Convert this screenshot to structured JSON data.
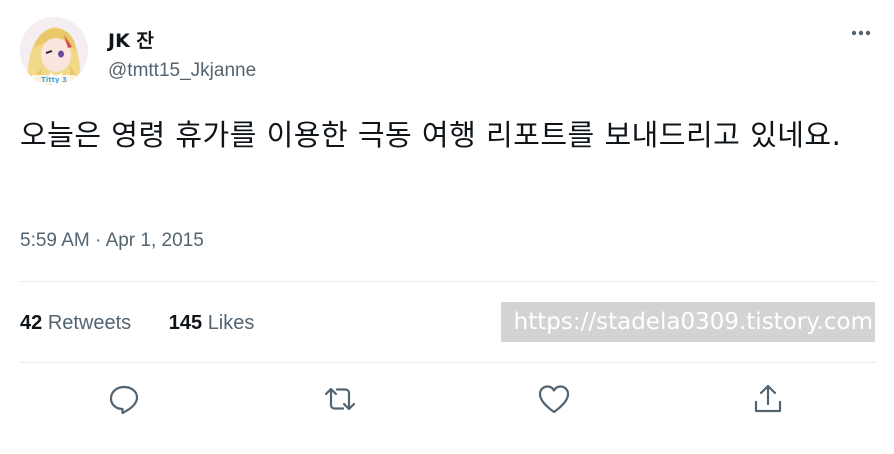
{
  "author": {
    "display_name": "JK 잔",
    "handle": "@tmtt15_Jkjanne",
    "avatar_text": "Titty 3"
  },
  "tweet": {
    "text": "오늘은 영령 휴가를 이용한 극동 여행 리포트를 보내드리고 있네요.",
    "time": "5:59 AM",
    "separator": "·",
    "date": "Apr 1, 2015"
  },
  "stats": {
    "retweets_count": "42",
    "retweets_label": "Retweets",
    "likes_count": "145",
    "likes_label": "Likes"
  },
  "watermark": {
    "text": "https://stadela0309.tistory.com"
  },
  "icons": {
    "more": "more-horizontal-icon",
    "reply": "reply-icon",
    "retweet": "retweet-icon",
    "like": "heart-icon",
    "share": "share-icon"
  },
  "colors": {
    "text_primary": "#0f1419",
    "text_secondary": "#536471",
    "divider": "#e6ecf0",
    "icon": "#536471",
    "watermark_bg": "#d3d3d3"
  }
}
